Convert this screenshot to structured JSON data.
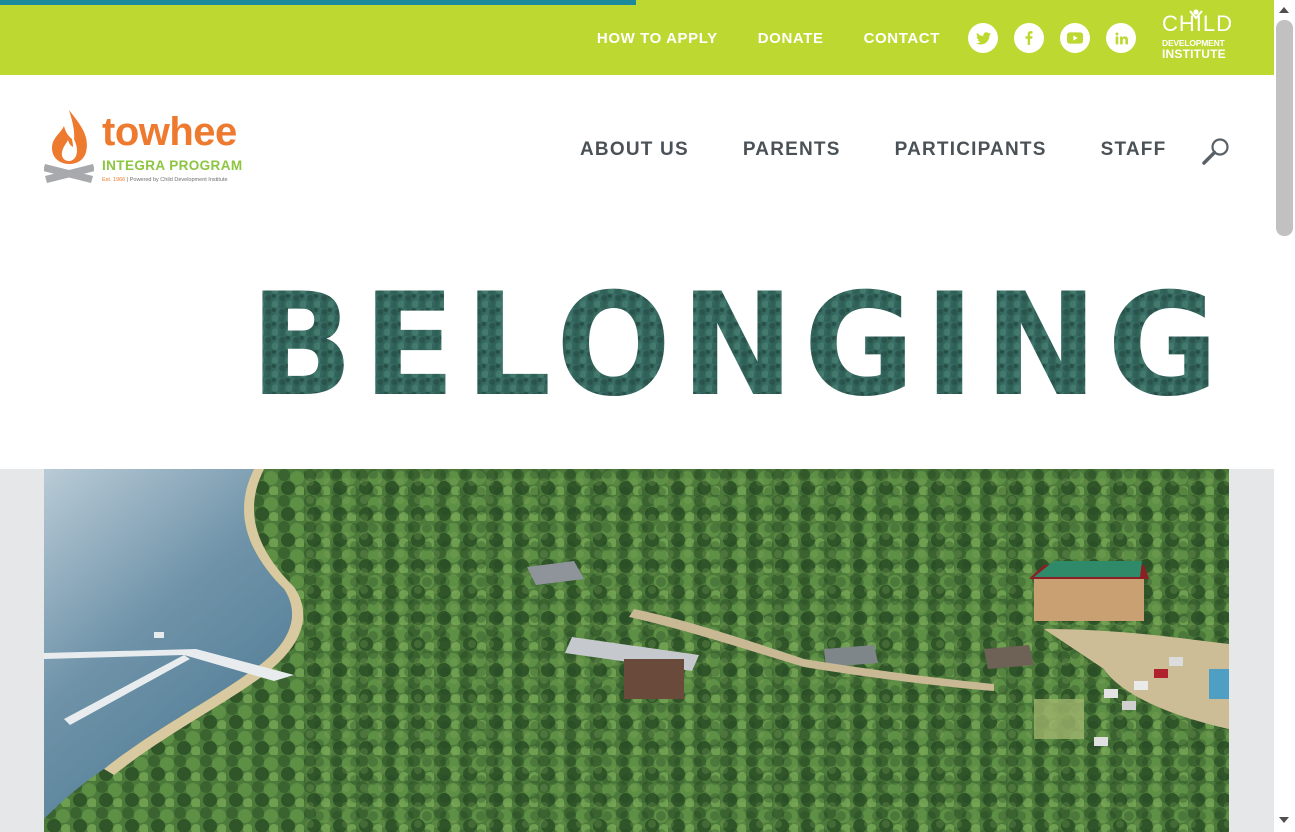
{
  "topbar": {
    "nav": [
      "HOW TO APPLY",
      "DONATE",
      "CONTACT"
    ],
    "socials": [
      "twitter-icon",
      "facebook-icon",
      "youtube-icon",
      "linkedin-icon"
    ],
    "partner_logo": {
      "line1": "CHILD",
      "line2": "DEVELOPMENT",
      "line3": "INSTITUTE"
    }
  },
  "logo": {
    "word": "towhee",
    "subtitle": "INTEGRA PROGRAM",
    "tag_est": "Est. 1966",
    "tag_rest": " | Powered by Child Development Institute"
  },
  "main_nav": [
    "ABOUT US",
    "PARENTS",
    "PARTICIPANTS",
    "STAFF"
  ],
  "headline": "BELONGING",
  "colors": {
    "accent_green": "#bdd831",
    "progress_teal": "#1b8a9c",
    "logo_orange": "#ee7a2f",
    "nav_text": "#4b5257"
  }
}
